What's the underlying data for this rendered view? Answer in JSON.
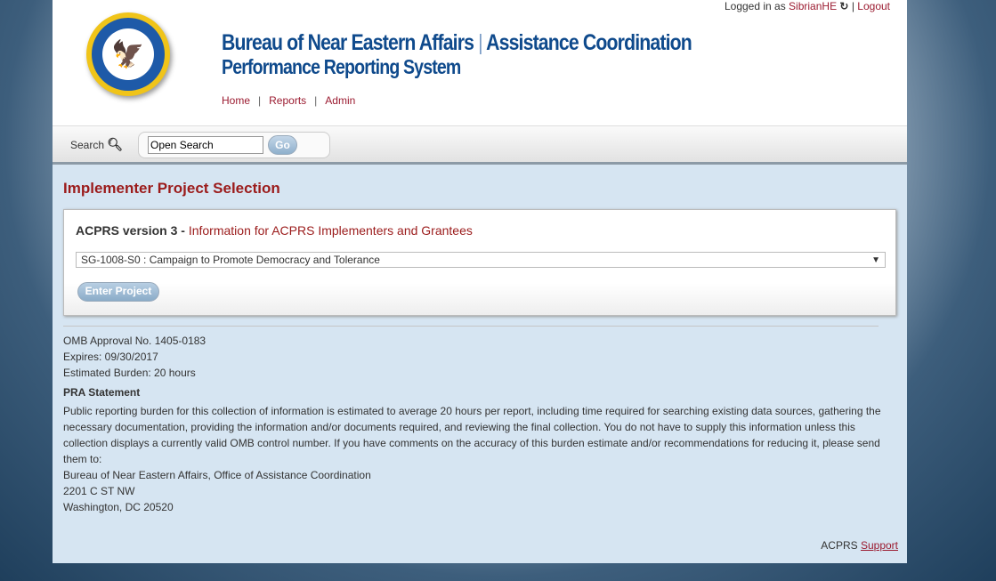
{
  "login": {
    "prefix": "Logged in as ",
    "user": "SibrianHE",
    "refresh_icon": "↻",
    "sep": "|",
    "logout": "Logout"
  },
  "header": {
    "title_left": "Bureau of Near Eastern Affairs",
    "title_sep": "|",
    "title_right": "Assistance Coordination",
    "subtitle": "Performance Reporting System"
  },
  "nav": [
    {
      "label": "Home"
    },
    {
      "label": "Reports"
    },
    {
      "label": "Admin"
    }
  ],
  "search": {
    "label": "Search",
    "value": "Open Search",
    "go": "Go"
  },
  "page_title": "Implementer Project Selection",
  "panel": {
    "version": "ACPRS version 3 - ",
    "info_link": "Information for ACPRS Implementers and Grantees",
    "selected_project": "SG-1008-S0 : Campaign to Promote Democracy and Tolerance",
    "enter": "Enter Project"
  },
  "info": {
    "omb": "OMB Approval No. 1405-0183",
    "expires": "Expires: 09/30/2017",
    "burden": "Estimated Burden: 20 hours",
    "pra_title": "PRA Statement",
    "pra_text": "Public reporting burden for this collection of information is estimated to average 20 hours per report, including time required for searching existing data sources, gathering the necessary documentation, providing the information and/or documents required, and reviewing the final collection. You do not have to supply this information unless this collection displays a currently valid OMB control number. If you have comments on the accuracy of this burden estimate and/or recommendations for reducing it, please send them to:",
    "addr1": "Bureau of Near Eastern Affairs, Office of Assistance Coordination",
    "addr2": "2201 C ST NW",
    "addr3": "Washington, DC 20520"
  },
  "footer": {
    "prefix": "ACPRS ",
    "support": "Support"
  }
}
